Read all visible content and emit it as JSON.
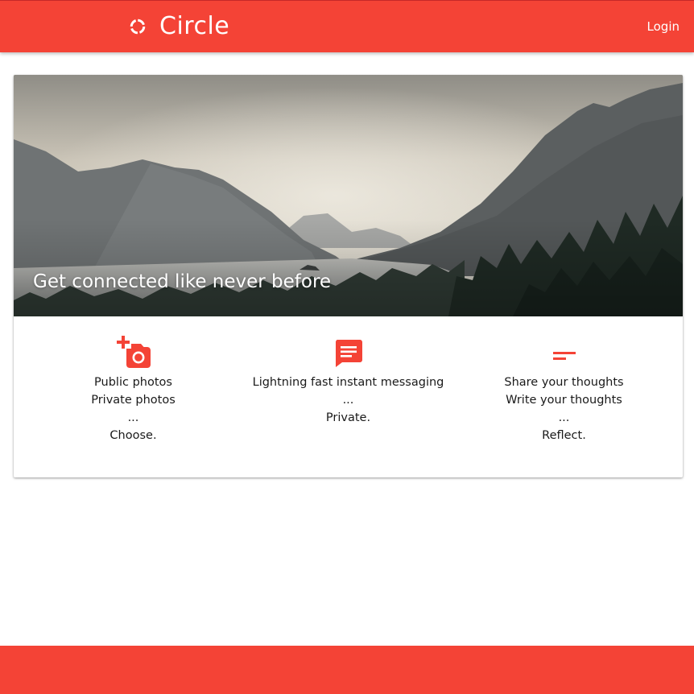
{
  "app": {
    "brand_name": "Circle",
    "brand_icon": "circle-logo-icon",
    "login_label": "Login",
    "accent_color": "#f44336"
  },
  "hero": {
    "title": "Get connected like never before",
    "image": "mountain-lake-landscape"
  },
  "features": [
    {
      "icon": "add-photo-camera-icon",
      "lines": [
        "Public photos",
        "Private photos",
        "...",
        "Choose."
      ]
    },
    {
      "icon": "chat-message-icon",
      "lines": [
        "Lightning fast instant messaging",
        "...",
        "Private."
      ]
    },
    {
      "icon": "short-text-icon",
      "lines": [
        "Share your thoughts",
        "Write your thoughts",
        "...",
        "Reflect."
      ]
    }
  ]
}
